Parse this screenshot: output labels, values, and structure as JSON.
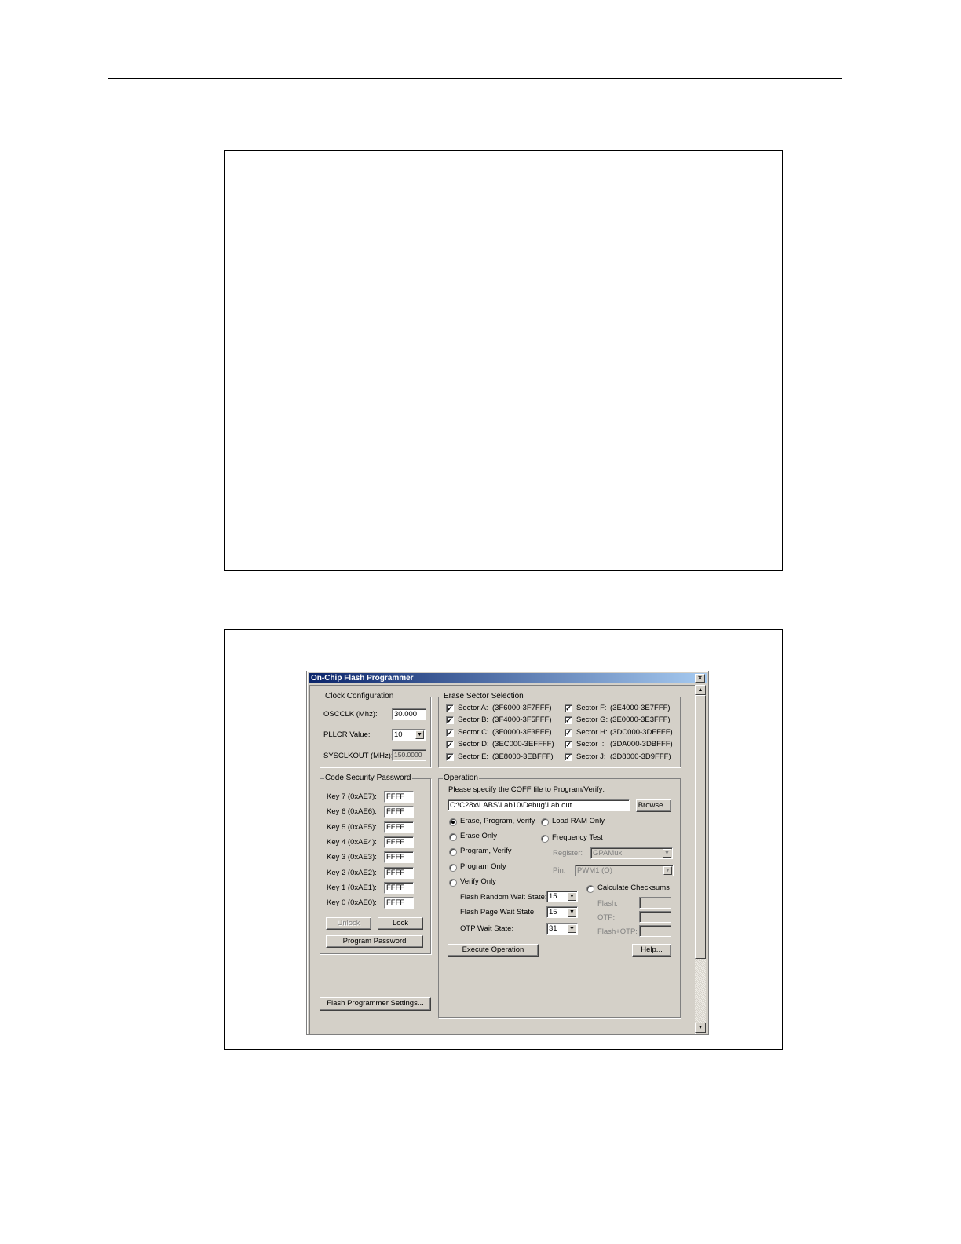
{
  "dialog": {
    "title": "On-Chip Flash Programmer",
    "close_glyph": "×",
    "clock": {
      "title": "Clock Configuration",
      "osclk_label": "OSCCLK (Mhz):",
      "osclk_value": "30.000",
      "pllcr_label": "PLLCR Value:",
      "pllcr_value": "10",
      "sysclk_label": "SYSCLKOUT (MHz):",
      "sysclk_value": "150.0000"
    },
    "erase": {
      "title": "Erase Sector Selection",
      "sectors": [
        {
          "name": "Sector A:",
          "range": "(3F6000-3F7FFF)",
          "checked": true
        },
        {
          "name": "Sector B:",
          "range": "(3F4000-3F5FFF)",
          "checked": true
        },
        {
          "name": "Sector C:",
          "range": "(3F0000-3F3FFF)",
          "checked": true
        },
        {
          "name": "Sector D:",
          "range": "(3EC000-3EFFFF)",
          "checked": true
        },
        {
          "name": "Sector E:",
          "range": "(3E8000-3EBFFF)",
          "checked": true
        },
        {
          "name": "Sector F:",
          "range": "(3E4000-3E7FFF)",
          "checked": true
        },
        {
          "name": "Sector G:",
          "range": "(3E0000-3E3FFF)",
          "checked": true
        },
        {
          "name": "Sector H:",
          "range": "(3DC000-3DFFFF)",
          "checked": true
        },
        {
          "name": "Sector I:",
          "range": "(3DA000-3DBFFF)",
          "checked": true
        },
        {
          "name": "Sector J:",
          "range": "(3D8000-3D9FFF)",
          "checked": true
        }
      ],
      "check_glyph": "✓"
    },
    "password": {
      "title": "Code Security Password",
      "keys": [
        {
          "label": "Key 7 (0xAE7):",
          "value": "FFFF"
        },
        {
          "label": "Key 6 (0xAE6):",
          "value": "FFFF"
        },
        {
          "label": "Key 5 (0xAE5):",
          "value": "FFFF"
        },
        {
          "label": "Key 4 (0xAE4):",
          "value": "FFFF"
        },
        {
          "label": "Key 3 (0xAE3):",
          "value": "FFFF"
        },
        {
          "label": "Key 2 (0xAE2):",
          "value": "FFFF"
        },
        {
          "label": "Key 1 (0xAE1):",
          "value": "FFFF"
        },
        {
          "label": "Key 0 (0xAE0):",
          "value": "FFFF"
        }
      ],
      "unlock_label": "Unlock",
      "lock_label": "Lock",
      "program_password_label": "Program Password"
    },
    "settings_label": "Flash Programmer Settings...",
    "operation": {
      "title": "Operation",
      "prompt": "Please specify the COFF file to Program/Verify:",
      "coff_path": "C:\\C28x\\LABS\\Lab10\\Debug\\Lab.out",
      "browse_label": "Browse...",
      "options_left": [
        {
          "label": "Erase, Program, Verify",
          "selected": true
        },
        {
          "label": "Erase Only",
          "selected": false
        },
        {
          "label": "Program, Verify",
          "selected": false
        },
        {
          "label": "Program Only",
          "selected": false
        },
        {
          "label": "Verify Only",
          "selected": false
        }
      ],
      "options_right": [
        {
          "label": "Load RAM Only",
          "selected": false
        },
        {
          "label": "Frequency Test",
          "selected": false
        }
      ],
      "register_label": "Register:",
      "register_value": "GPAMux",
      "pin_label": "Pin:",
      "pin_value": "PWM1 (O)",
      "random_wait_label": "Flash Random Wait State:",
      "random_wait_value": "15",
      "page_wait_label": "Flash Page Wait State:",
      "page_wait_value": "15",
      "otp_wait_label": "OTP Wait State:",
      "otp_wait_value": "31",
      "checksums_label": "Calculate Checksums",
      "flash_label": "Flash:",
      "otp_label": "OTP:",
      "flash_otp_label": "Flash+OTP:",
      "execute_label": "Execute Operation",
      "help_label": "Help..."
    },
    "scroll_up_glyph": "▲",
    "scroll_down_glyph": "▼",
    "combo_arrow_glyph": "▼"
  }
}
